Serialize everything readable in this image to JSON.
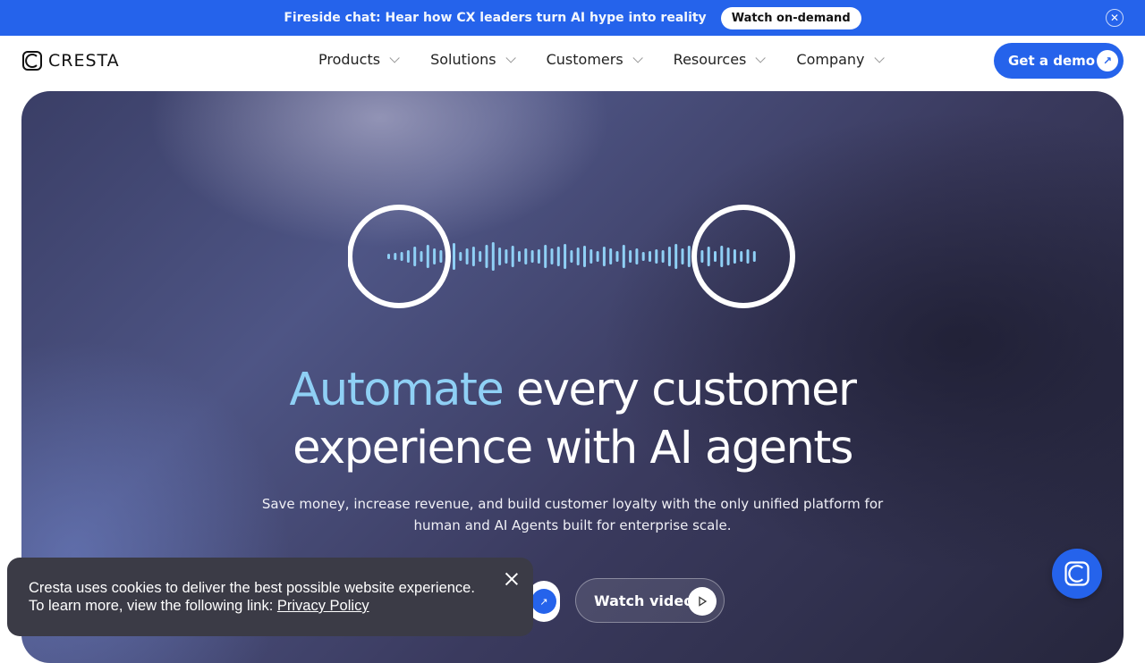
{
  "banner": {
    "text": "Fireside chat: Hear how CX leaders turn AI hype into reality",
    "button_label": "Watch on-demand",
    "close_icon": "close-icon"
  },
  "nav": {
    "logo_text": "CRESTA",
    "menu": [
      {
        "label": "Products"
      },
      {
        "label": "Solutions"
      },
      {
        "label": "Customers"
      },
      {
        "label": "Resources"
      },
      {
        "label": "Company"
      }
    ],
    "cta_label": "Get a demo"
  },
  "hero": {
    "headline_accent": "Automate",
    "headline_rest": " every customer",
    "headline_line2": "experience with AI agents",
    "subtitle_line1": "Save money, increase revenue, and build customer loyalty with the only unified platform for",
    "subtitle_line2": "human and AI Agents built for enterprise scale.",
    "video_button_label": "Watch video"
  },
  "cookie": {
    "text": "Cresta uses cookies to deliver the best possible website experience. To learn more, view the following link: ",
    "link_label": "Privacy Policy"
  },
  "colors": {
    "brand_blue": "#2563eb",
    "accent_cyan": "#8fd0f5"
  }
}
